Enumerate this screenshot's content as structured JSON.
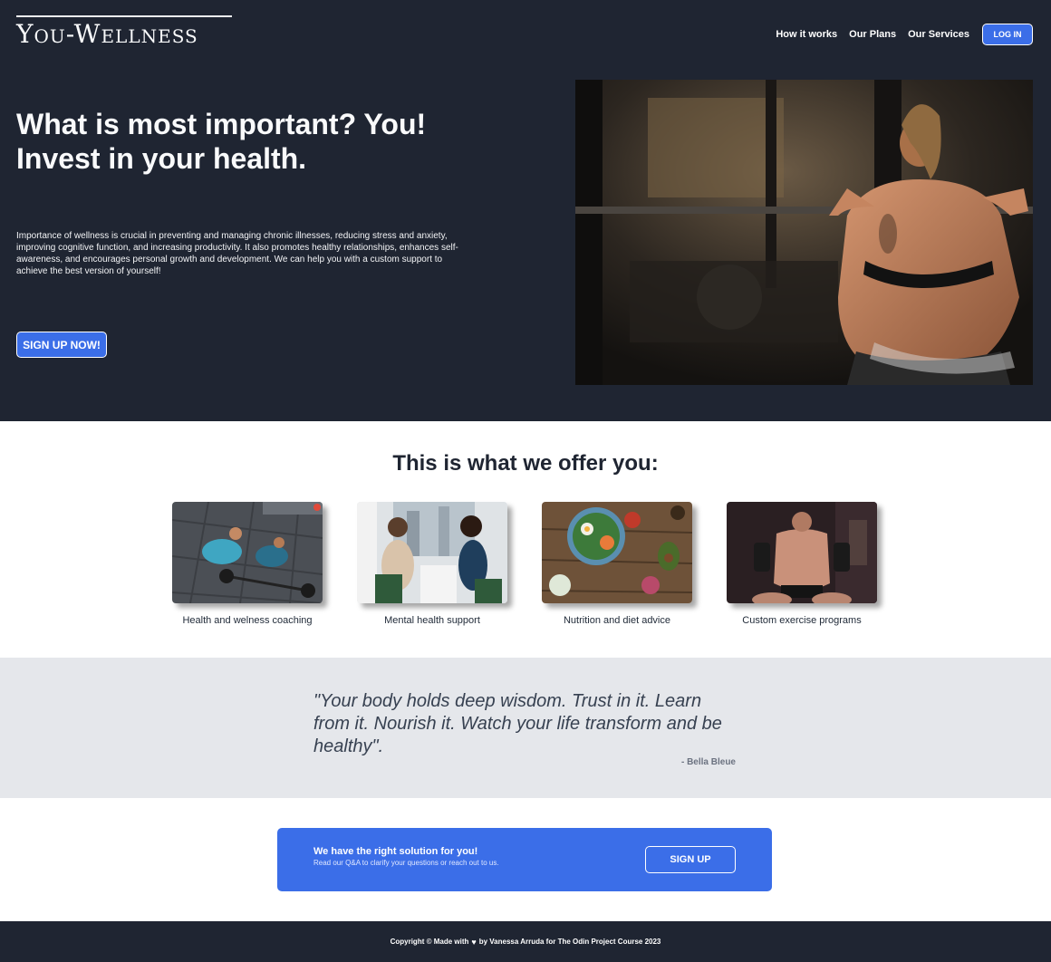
{
  "header": {
    "logo": "You-Wellness",
    "nav": [
      "How it works",
      "Our Plans",
      "Our Services"
    ],
    "login_label": "LOG IN"
  },
  "hero": {
    "title_line1": "What is most important? You!",
    "title_line2": "Invest in your health.",
    "description": "Importance of wellness is crucial in preventing and managing chronic illnesses, reducing stress and anxiety, improving cognitive function, and increasing productivity. It also promotes healthy relationships, enhances self-awareness, and encourages personal growth and development. We can help you with a custom support to achieve the best version of yourself!",
    "signup_label": "SIGN UP NOW!"
  },
  "offers": {
    "title": "This is what we offer you:",
    "items": [
      {
        "label": "Health and welness coaching"
      },
      {
        "label": "Mental health support"
      },
      {
        "label": "Nutrition and diet advice"
      },
      {
        "label": "Custom exercise programs"
      }
    ]
  },
  "quote": {
    "text": "\"Your body holds deep wisdom. Trust in it. Learn from it. Nourish it. Watch your life transform and be healthy\".",
    "author": "- Bella Bleue"
  },
  "cta": {
    "title": "We have the right solution for you!",
    "subtitle": "Read our Q&A to clarify your questions or reach out to us.",
    "signup_label": "SIGN UP"
  },
  "footer": {
    "text_before": "Copyright © Made with",
    "heart_icon": "heart-icon",
    "text_after": "by Vanessa Arruda for The Odin Project Course 2023"
  },
  "colors": {
    "dark": "#1f2532",
    "accent": "#3b6ee8",
    "quote_bg": "#e5e7eb"
  }
}
